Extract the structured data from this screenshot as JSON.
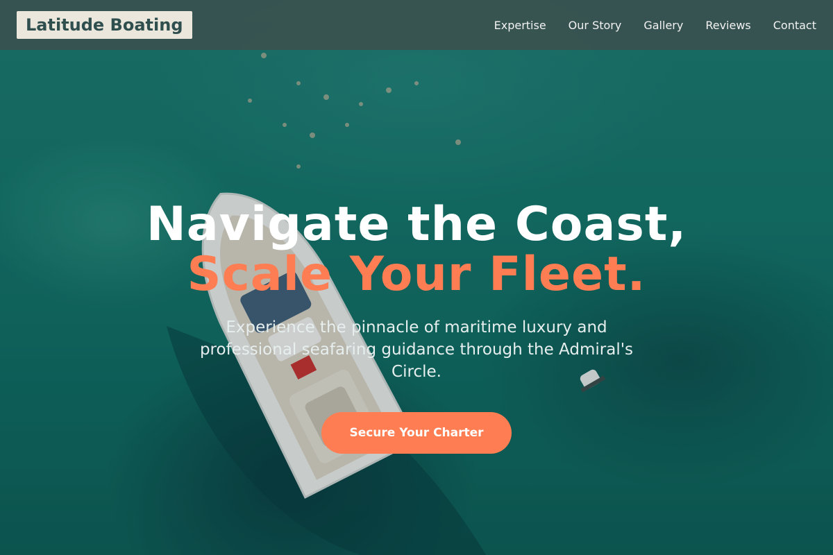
{
  "brand": {
    "name": "Latitude Boating"
  },
  "nav": {
    "items": [
      {
        "label": "Expertise"
      },
      {
        "label": "Our Story"
      },
      {
        "label": "Gallery"
      },
      {
        "label": "Reviews"
      },
      {
        "label": "Contact"
      }
    ]
  },
  "hero": {
    "headline_line1": "Navigate the Coast,",
    "headline_line2": "Scale Your Fleet.",
    "subtitle": "Experience the pinnacle of maritime luxury and professional seafaring guidance through the Admiral's Circle.",
    "cta_label": "Secure Your Charter"
  },
  "colors": {
    "accent": "#ff7d52",
    "nav_bg": "#3a5250",
    "brand_bg": "#ece7dc",
    "brand_text": "#2f4f4f",
    "sea": "#11756b"
  }
}
